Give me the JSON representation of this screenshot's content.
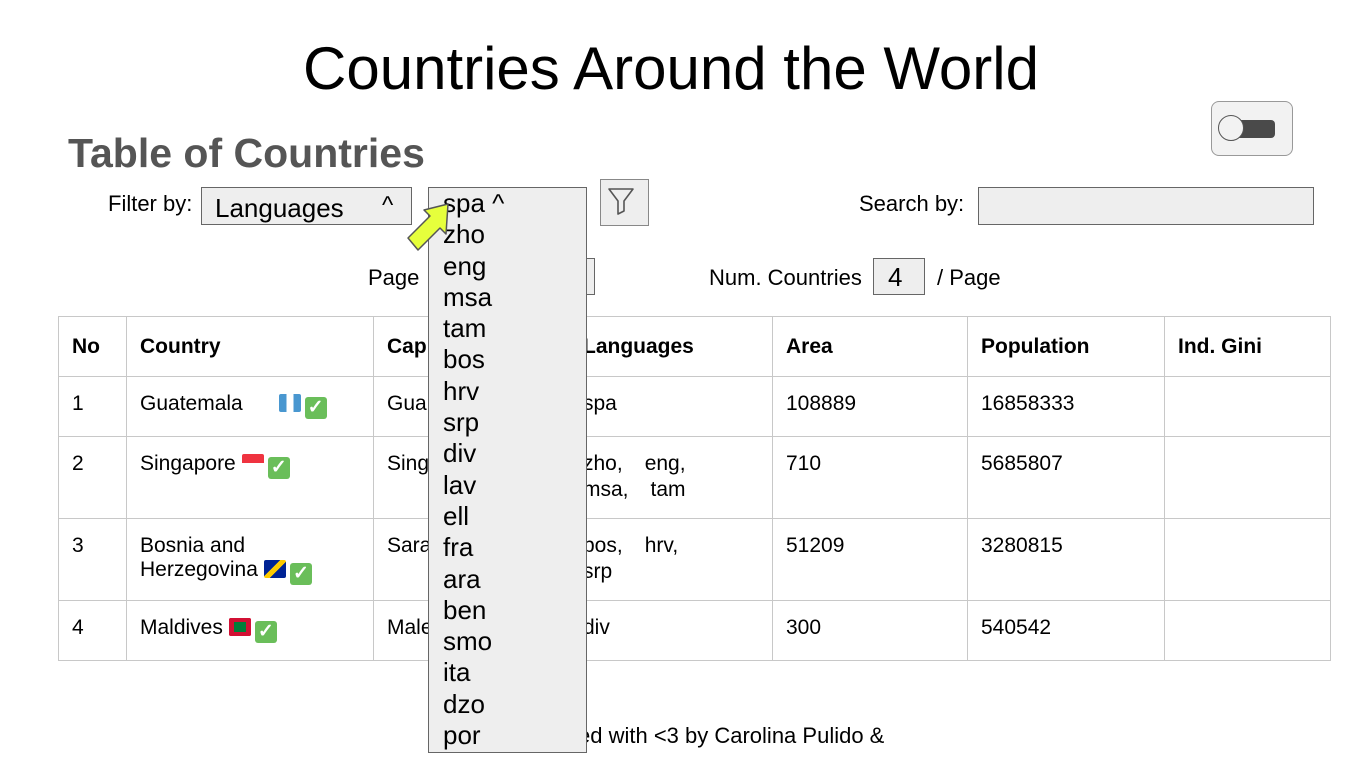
{
  "header": {
    "title": "Countries Around the World"
  },
  "section": {
    "title": "Table of Countries"
  },
  "filter": {
    "label": "Filter by:",
    "selected": "Languages",
    "caret": "^",
    "value_selected": "spa",
    "value_caret": "^",
    "options": [
      "spa",
      "zho",
      "eng",
      "msa",
      "tam",
      "bos",
      "hrv",
      "srp",
      "div",
      "lav",
      "ell",
      "fra",
      "ara",
      "ben",
      "smo",
      "ita",
      "dzo",
      "por"
    ]
  },
  "search": {
    "label": "Search by:",
    "value": ""
  },
  "pagination": {
    "label": "Page",
    "num_label": "Num. Countries",
    "num_value": "4",
    "suffix": "/ Page"
  },
  "table": {
    "headers": [
      "No",
      "Country",
      "Cap",
      "Languages",
      "Area",
      "Population",
      "Ind. Gini"
    ],
    "rows": [
      {
        "no": "1",
        "country": "Guatemala",
        "capital": "Gua",
        "languages": [
          "spa"
        ],
        "area": "108889",
        "population": "16858333",
        "gini": ""
      },
      {
        "no": "2",
        "country": "Singapore",
        "capital": "Sing",
        "languages": [
          "zho,",
          "eng,",
          "msa,",
          "tam"
        ],
        "area": "710",
        "population": "5685807",
        "gini": ""
      },
      {
        "no": "3",
        "country": "Bosnia and Herzegovina",
        "capital": "Sara",
        "languages": [
          "bos,",
          "hrv,",
          "srp"
        ],
        "area": "51209",
        "population": "3280815",
        "gini": ""
      },
      {
        "no": "4",
        "country": "Maldives",
        "capital": "Male",
        "languages": [
          "div"
        ],
        "area": "300",
        "population": "540542",
        "gini": ""
      }
    ]
  },
  "footer": {
    "text": "ed with <3 by Carolina Pulido &"
  },
  "icons": {
    "filter": "funnel-icon",
    "toggle": "theme-toggle",
    "cursor": "arrow-cursor-icon",
    "check": "check-icon"
  },
  "colors": {
    "check": "#6abe5a",
    "cursor": "#e6ff3c",
    "subtitle": "#555555"
  }
}
